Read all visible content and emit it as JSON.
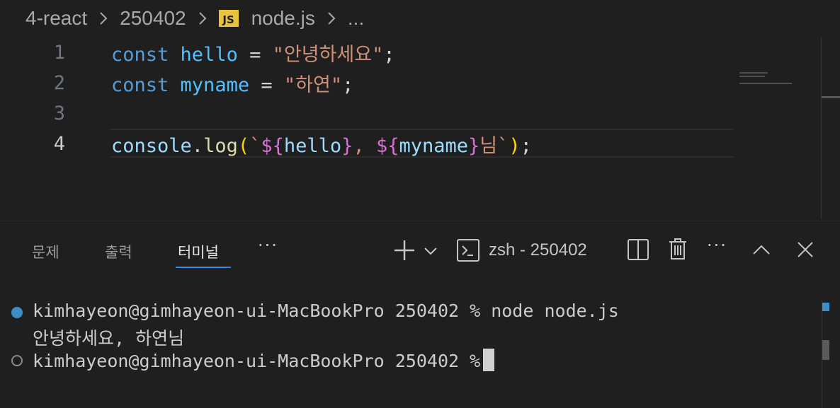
{
  "breadcrumb": {
    "items": [
      "4-react",
      "250402",
      "node.js",
      "..."
    ],
    "js_badge": "JS"
  },
  "editor": {
    "line_numbers": [
      "1",
      "2",
      "3",
      "4"
    ],
    "line1": {
      "kw": "const",
      "var": "hello",
      "op": "=",
      "str": "\"안녕하세요\"",
      "end": ";"
    },
    "line2": {
      "kw": "const",
      "var": "myname",
      "op": "=",
      "str": "\"하연\"",
      "end": ";"
    },
    "line4": {
      "obj": "console",
      "dot": ".",
      "fn": "log",
      "open": "(",
      "tick1": "`",
      "d1": "${",
      "v1": "hello",
      "c1": "}",
      "sep": ", ",
      "d2": "${",
      "v2": "myname",
      "c2": "}",
      "suffix": "님",
      "tick2": "`",
      "close": ")",
      "end": ";"
    }
  },
  "panel": {
    "tabs": [
      "문제",
      "출력",
      "터미널"
    ],
    "active_tab": "터미널",
    "more": "···",
    "terminal_name": "zsh - 250402"
  },
  "terminal": {
    "line1": "kimhayeon@gimhayeon-ui-MacBookPro 250402 % node node.js",
    "line2": "안녕하세요, 하연님",
    "line3": "kimhayeon@gimhayeon-ui-MacBookPro 250402 %"
  },
  "colors": {
    "accent": "#2f8ae0",
    "js_badge": "#e8c33b",
    "background": "#1f1f1f"
  }
}
